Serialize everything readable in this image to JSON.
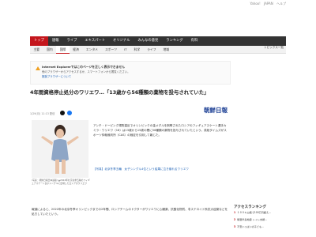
{
  "header": {
    "top_links": [
      "Yahoo!",
      "JAPAN",
      "ヘルプ"
    ]
  },
  "nav_primary": [
    "トップ",
    "速報",
    "ライブ",
    "エキスパート",
    "オリジナル",
    "みんなの意見",
    "ランキング",
    "有料"
  ],
  "nav_secondary": [
    "主要",
    "国内",
    "国際",
    "経済",
    "エンタメ",
    "スポーツ",
    "IT",
    "科学",
    "ライフ",
    "地域"
  ],
  "nav_secondary_right": "トピックス一覧",
  "notice": {
    "title": "Internet Explorerではこのページを正しく表示できません",
    "line1": "他のブラウザーからアクセスするか、スマートフォンから閲覧ください。",
    "link": "推奨ブラウザーについて"
  },
  "article": {
    "headline": "4年間資格停止処分のワリエワ…「13歳から56種類の薬物を投与されていた」",
    "meta": "1/29(月) 11:13 配信",
    "source_logo": "朝鮮日報",
    "photo_caption": "(写真：朝鮮日報日本語版) ▲2022年北京冬季五輪のフィギュアスケート女子シングルに出場したロシアのワリエワ",
    "body_intro": "アンチ・ドーピング規則違反でオリンピックの金メダルを剥奪されたロシアのフィギュアスケート選手カミラ・ワリエワ（18）は13歳から15歳の間に56種類の薬物を投与されていたという。英紙タイムズがスポーツ仲裁裁判所（CAS）の裁定を引用して報じた。",
    "photo_link": "【写真】北京冬季五輪　女子シングル4位という結果に泣き崩れるワリエワ",
    "body_main": "報道によると、2022年の北京冬季オリンピックまでの2年間、ロシアチームのドクターがワリエワに心臓薬、抗酸化物質、非ステロイド系抗炎症薬などを処方していたという。"
  },
  "sidebar": {
    "ranking_title": "アクセスランキング",
    "ranking": [
      {
        "num": "1",
        "text": "１００キロ級で100万円超え…"
      },
      {
        "num": "2",
        "text": "能登半島地震 トイレ支援…"
      },
      {
        "num": "3",
        "text": "不安いっぱいの子ども…"
      }
    ]
  },
  "colors": {
    "accent": "#c4161c",
    "nav_bg": "#333333",
    "link": "#1a5fb4"
  }
}
